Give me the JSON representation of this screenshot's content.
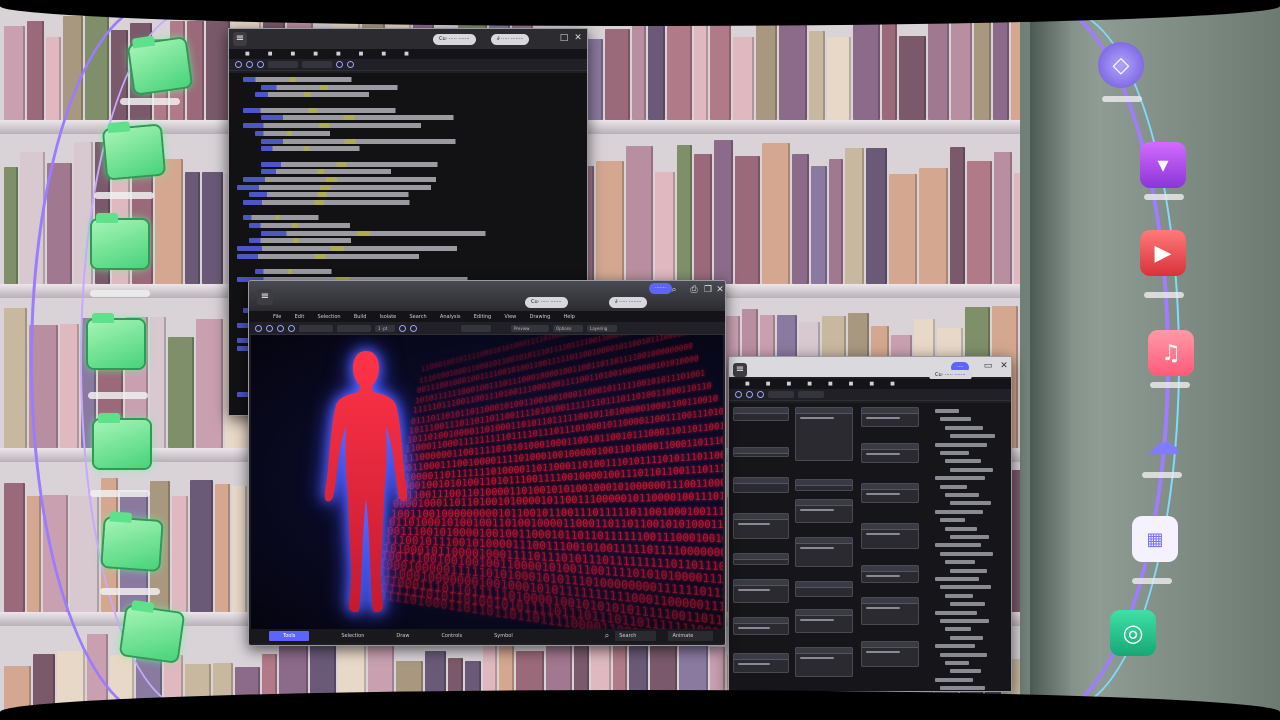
{
  "code_window": {
    "tabs": [
      "Cu·  ·····  ·······",
      "∂ ·····  ········"
    ],
    "controls": [
      "□",
      "✕"
    ]
  },
  "viewer_window": {
    "badge": "·······",
    "tabs": [
      "Cu·  ·····  ·······",
      "∂ ·····  ········"
    ],
    "menu": [
      "File",
      "Edit",
      "Selection",
      "Build",
      "Isolate",
      "Search",
      "Analysis",
      "Editing",
      "View",
      "Drawing",
      "Help"
    ],
    "toolbar": {
      "zoom": "1 ·pt",
      "right_buttons": [
        "Preview",
        "Options",
        "Layering"
      ]
    },
    "bottom_tabs": [
      "Tools",
      "Selection",
      "Draw",
      "Controls",
      "Symbol"
    ],
    "bottom_active": "Tools",
    "bottom_search": "Search",
    "bottom_select": "Animate"
  },
  "node_window": {
    "badge": "····",
    "tabs": [
      "Cu·  ·····  ·······"
    ]
  },
  "colors": {
    "binary_red": "#d4142a",
    "figure_red": "#e0223a",
    "figure_glow": "#4b5bff",
    "folder_green": "#48d37a",
    "dock_arc": "#b18cff"
  },
  "left_dock": {
    "icons": [
      "folder-icon",
      "folder-icon",
      "folder-icon",
      "folder-icon",
      "folder-icon",
      "folder-icon",
      "folder-icon"
    ]
  },
  "right_dock": {
    "icons": [
      "cube-app-icon",
      "shopping-bag-icon",
      "video-player-icon",
      "music-icon",
      "cloud-icon",
      "calendar-icon",
      "circle-app-icon"
    ]
  }
}
